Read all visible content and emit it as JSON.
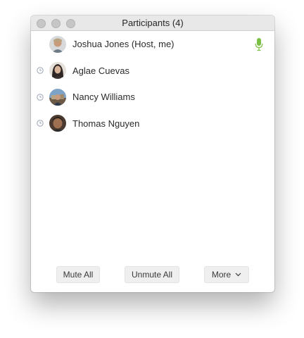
{
  "window": {
    "title": "Participants (4)"
  },
  "participants": [
    {
      "name": "Joshua Jones (Host, me)",
      "status_icon": "none",
      "mic_icon": "microphone-icon",
      "mic_color": "#7ac043"
    },
    {
      "name": "Aglae Cuevas",
      "status_icon": "clock-icon"
    },
    {
      "name": "Nancy Williams",
      "status_icon": "clock-icon"
    },
    {
      "name": "Thomas Nguyen",
      "status_icon": "clock-icon"
    }
  ],
  "footer": {
    "mute_all_label": "Mute All",
    "unmute_all_label": "Unmute All",
    "more_label": "More"
  },
  "colors": {
    "titlebar_bg": "#e8e8e8",
    "traffic_light": "#c6c6c6",
    "mic_active": "#7ac043",
    "status_icon": "#9aa3b5",
    "button_bg": "#efefef"
  }
}
